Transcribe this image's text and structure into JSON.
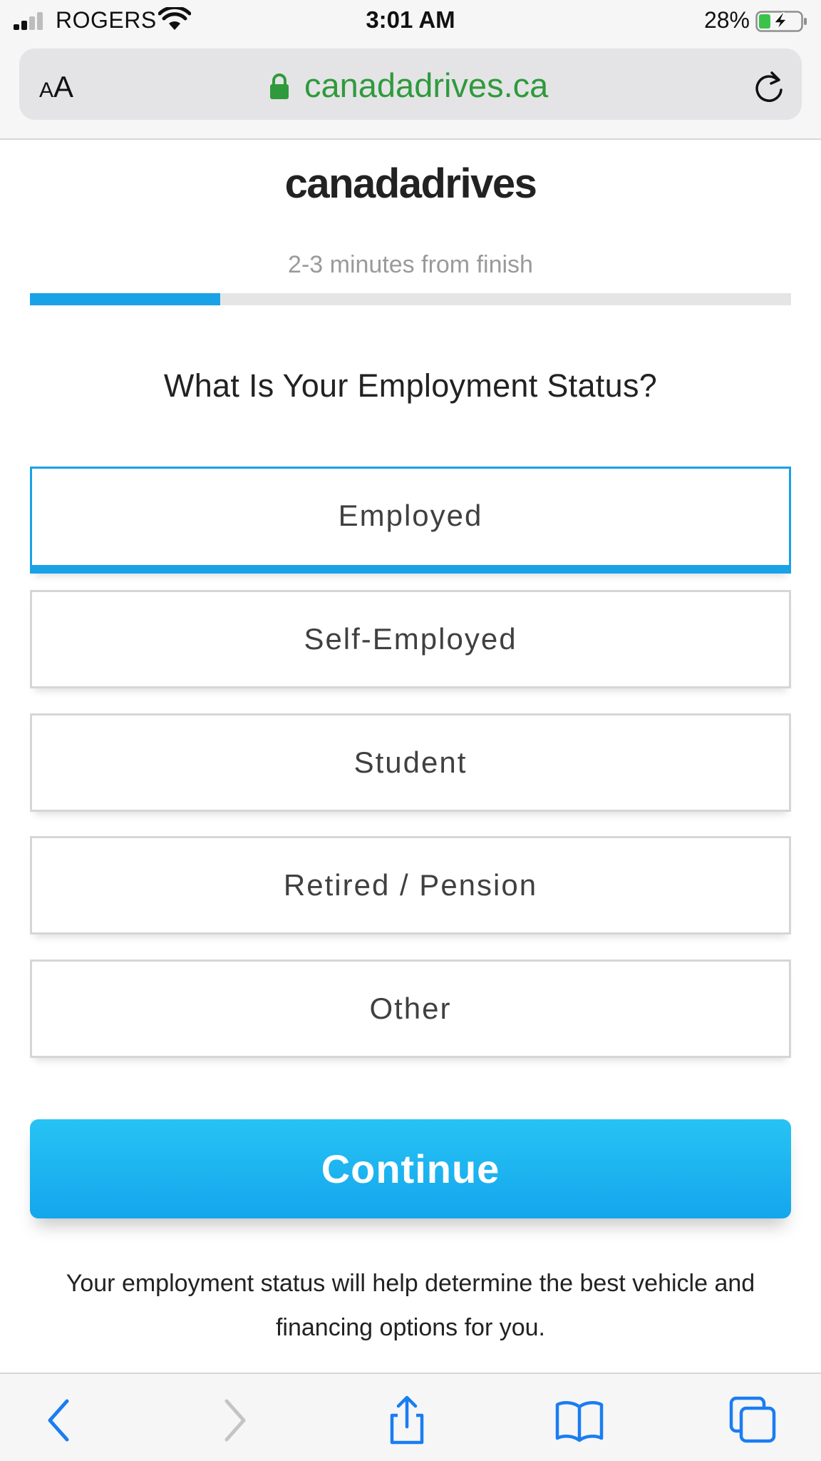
{
  "status_bar": {
    "carrier": "ROGERS",
    "time": "3:01 AM",
    "battery_percent": "28%",
    "battery_level": 0.28
  },
  "browser": {
    "text_size_small": "A",
    "text_size_large": "A",
    "domain": "canadadrives.ca"
  },
  "page": {
    "logo_text": "canadadrives",
    "progress_text": "2-3 minutes from finish",
    "progress_fraction": 0.25,
    "question": "What Is Your Employment Status?",
    "options": [
      {
        "label": "Employed",
        "selected": true
      },
      {
        "label": "Self-Employed",
        "selected": false
      },
      {
        "label": "Student",
        "selected": false
      },
      {
        "label": "Retired / Pension",
        "selected": false
      },
      {
        "label": "Other",
        "selected": false
      }
    ],
    "continue_label": "Continue",
    "helper_text": "Your employment status will help determine the best vehicle and financing options for you."
  },
  "toolbar": {
    "back": "chevron-left-icon",
    "forward": "chevron-right-icon",
    "share": "share-icon",
    "bookmarks": "book-icon",
    "tabs": "tabs-icon"
  },
  "colors": {
    "accent": "#1aa2e6",
    "secure_green": "#2f9a3c",
    "ios_blue": "#1a7df2"
  }
}
